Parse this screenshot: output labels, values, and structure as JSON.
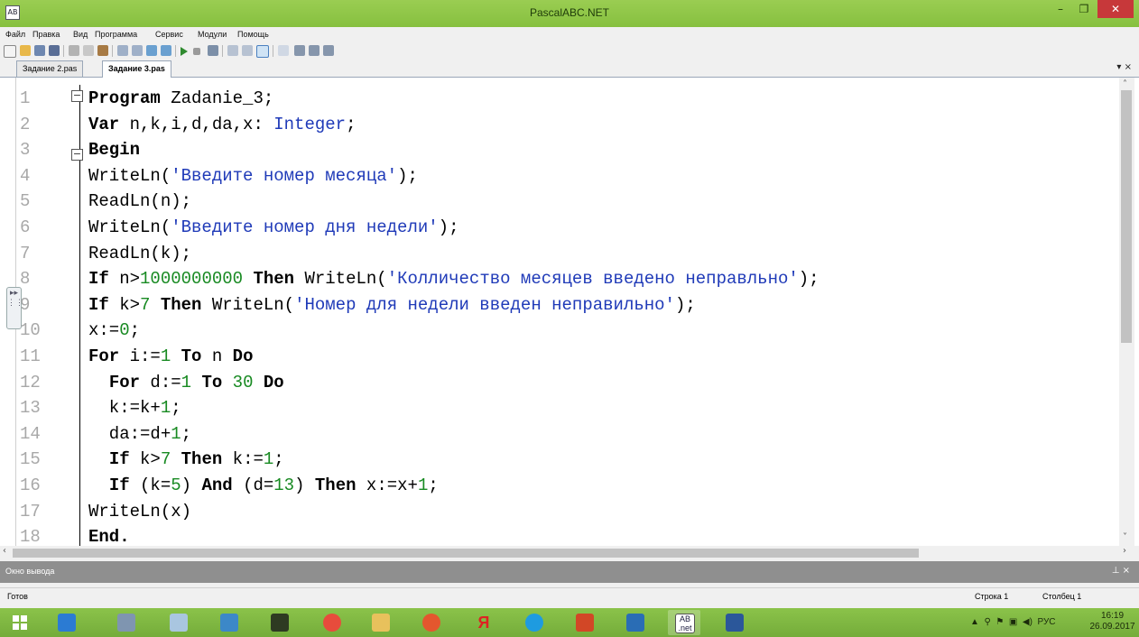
{
  "window": {
    "title": "PascalABC.NET",
    "app_icon": "AB"
  },
  "menu": [
    "Файл",
    "Правка",
    "Вид",
    "Программа",
    "Сервис",
    "Модули",
    "Помощь"
  ],
  "tabs": [
    {
      "label": "Задание 2.pas",
      "active": false
    },
    {
      "label": "Задание 3.pas",
      "active": true
    }
  ],
  "tab_controls": "▾ ×",
  "code": {
    "line_numbers": [
      "1",
      "2",
      "3",
      "4",
      "5",
      "6",
      "7",
      "8",
      "9",
      "10",
      "11",
      "12",
      "13",
      "14",
      "15",
      "16",
      "17",
      "18"
    ],
    "lines": [
      [
        {
          "t": "Program",
          "c": "kw"
        },
        {
          "t": " Zadanie_3;",
          "c": ""
        }
      ],
      [
        {
          "t": "Var",
          "c": "kw"
        },
        {
          "t": " n,k,i,d,da,x: ",
          "c": ""
        },
        {
          "t": "Integer",
          "c": "typ"
        },
        {
          "t": ";",
          "c": ""
        }
      ],
      [
        {
          "t": "Begin",
          "c": "kw"
        }
      ],
      [
        {
          "t": "WriteLn(",
          "c": ""
        },
        {
          "t": "'Введите номер месяца'",
          "c": "str"
        },
        {
          "t": ");",
          "c": ""
        }
      ],
      [
        {
          "t": "ReadLn(n);",
          "c": ""
        }
      ],
      [
        {
          "t": "WriteLn(",
          "c": ""
        },
        {
          "t": "'Введите номер дня недели'",
          "c": "str"
        },
        {
          "t": ");",
          "c": ""
        }
      ],
      [
        {
          "t": "ReadLn(k);",
          "c": ""
        }
      ],
      [
        {
          "t": "If",
          "c": "kw"
        },
        {
          "t": " n>",
          "c": ""
        },
        {
          "t": "1000000000",
          "c": "num"
        },
        {
          "t": " ",
          "c": ""
        },
        {
          "t": "Then",
          "c": "kw"
        },
        {
          "t": " WriteLn(",
          "c": ""
        },
        {
          "t": "'Колличество месяцев введено неправльно'",
          "c": "str"
        },
        {
          "t": ");",
          "c": ""
        }
      ],
      [
        {
          "t": "If",
          "c": "kw"
        },
        {
          "t": " k>",
          "c": ""
        },
        {
          "t": "7",
          "c": "num"
        },
        {
          "t": " ",
          "c": ""
        },
        {
          "t": "Then",
          "c": "kw"
        },
        {
          "t": " WriteLn(",
          "c": ""
        },
        {
          "t": "'Номер для недели введен неправильно'",
          "c": "str"
        },
        {
          "t": ");",
          "c": ""
        }
      ],
      [
        {
          "t": "x:=",
          "c": ""
        },
        {
          "t": "0",
          "c": "num"
        },
        {
          "t": ";",
          "c": ""
        }
      ],
      [
        {
          "t": "For",
          "c": "kw"
        },
        {
          "t": " i:=",
          "c": ""
        },
        {
          "t": "1",
          "c": "num"
        },
        {
          "t": " ",
          "c": ""
        },
        {
          "t": "To",
          "c": "kw"
        },
        {
          "t": " n ",
          "c": ""
        },
        {
          "t": "Do",
          "c": "kw"
        }
      ],
      [
        {
          "t": "  ",
          "c": ""
        },
        {
          "t": "For",
          "c": "kw"
        },
        {
          "t": " d:=",
          "c": ""
        },
        {
          "t": "1",
          "c": "num"
        },
        {
          "t": " ",
          "c": ""
        },
        {
          "t": "To",
          "c": "kw"
        },
        {
          "t": " ",
          "c": ""
        },
        {
          "t": "30",
          "c": "num"
        },
        {
          "t": " ",
          "c": ""
        },
        {
          "t": "Do",
          "c": "kw"
        }
      ],
      [
        {
          "t": "  k:=k+",
          "c": ""
        },
        {
          "t": "1",
          "c": "num"
        },
        {
          "t": ";",
          "c": ""
        }
      ],
      [
        {
          "t": "  da:=d+",
          "c": ""
        },
        {
          "t": "1",
          "c": "num"
        },
        {
          "t": ";",
          "c": ""
        }
      ],
      [
        {
          "t": "  ",
          "c": ""
        },
        {
          "t": "If",
          "c": "kw"
        },
        {
          "t": " k>",
          "c": ""
        },
        {
          "t": "7",
          "c": "num"
        },
        {
          "t": " ",
          "c": ""
        },
        {
          "t": "Then",
          "c": "kw"
        },
        {
          "t": " k:=",
          "c": ""
        },
        {
          "t": "1",
          "c": "num"
        },
        {
          "t": ";",
          "c": ""
        }
      ],
      [
        {
          "t": "  ",
          "c": ""
        },
        {
          "t": "If",
          "c": "kw"
        },
        {
          "t": " (k=",
          "c": ""
        },
        {
          "t": "5",
          "c": "num"
        },
        {
          "t": ") ",
          "c": ""
        },
        {
          "t": "And",
          "c": "kw"
        },
        {
          "t": " (d=",
          "c": ""
        },
        {
          "t": "13",
          "c": "num"
        },
        {
          "t": ") ",
          "c": ""
        },
        {
          "t": "Then",
          "c": "kw"
        },
        {
          "t": " x:=x+",
          "c": ""
        },
        {
          "t": "1",
          "c": "num"
        },
        {
          "t": ";",
          "c": ""
        }
      ],
      [
        {
          "t": "WriteLn(x)",
          "c": ""
        }
      ],
      [
        {
          "t": "End.",
          "c": "kw"
        }
      ]
    ]
  },
  "output_panel": {
    "title": "Окно вывода",
    "controls": "⊥ ×"
  },
  "status": {
    "ready": "Готов",
    "row": "Строка 1",
    "col": "Столбец 1"
  },
  "tray": {
    "lang": "РУС",
    "time": "16:19",
    "date": "26.09.2017"
  },
  "colors": {
    "titlebar": "#8bc34a",
    "close": "#c7383a",
    "string": "#1f3ab8",
    "number": "#188a22"
  }
}
